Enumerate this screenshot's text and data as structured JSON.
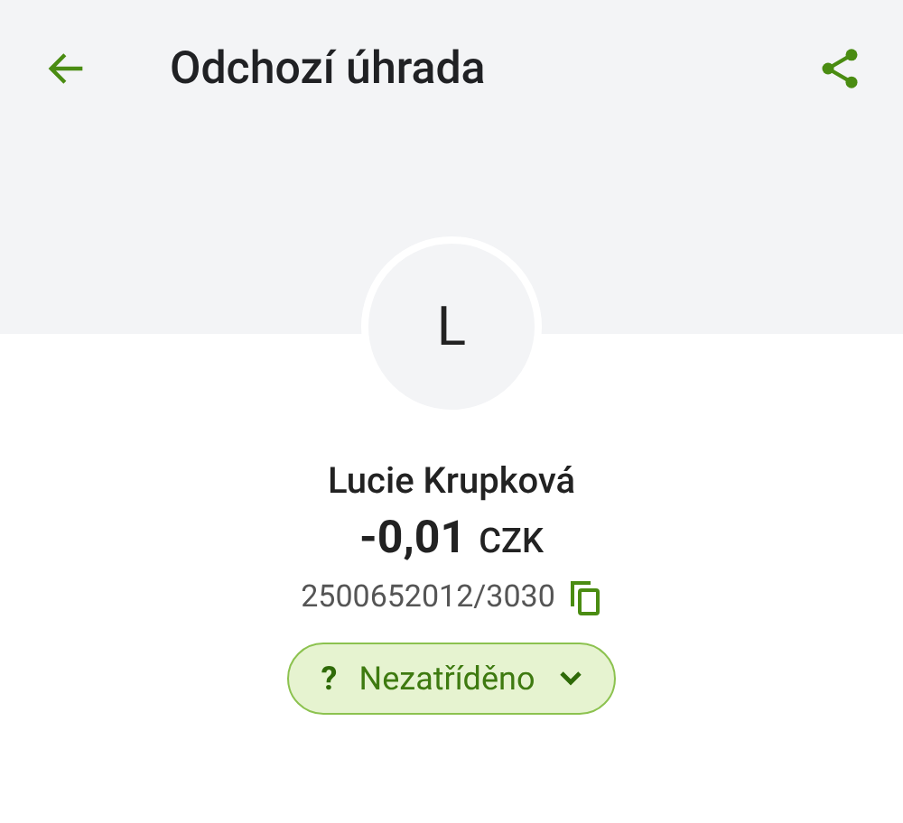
{
  "header": {
    "title": "Odchozí úhrada"
  },
  "avatar": {
    "initial": "L"
  },
  "payment": {
    "name": "Lucie Krupková",
    "amount": "-0,01",
    "currency": "CZK",
    "account": "2500652012/3030"
  },
  "category": {
    "mark": "?",
    "label": "Nezatříděno"
  }
}
